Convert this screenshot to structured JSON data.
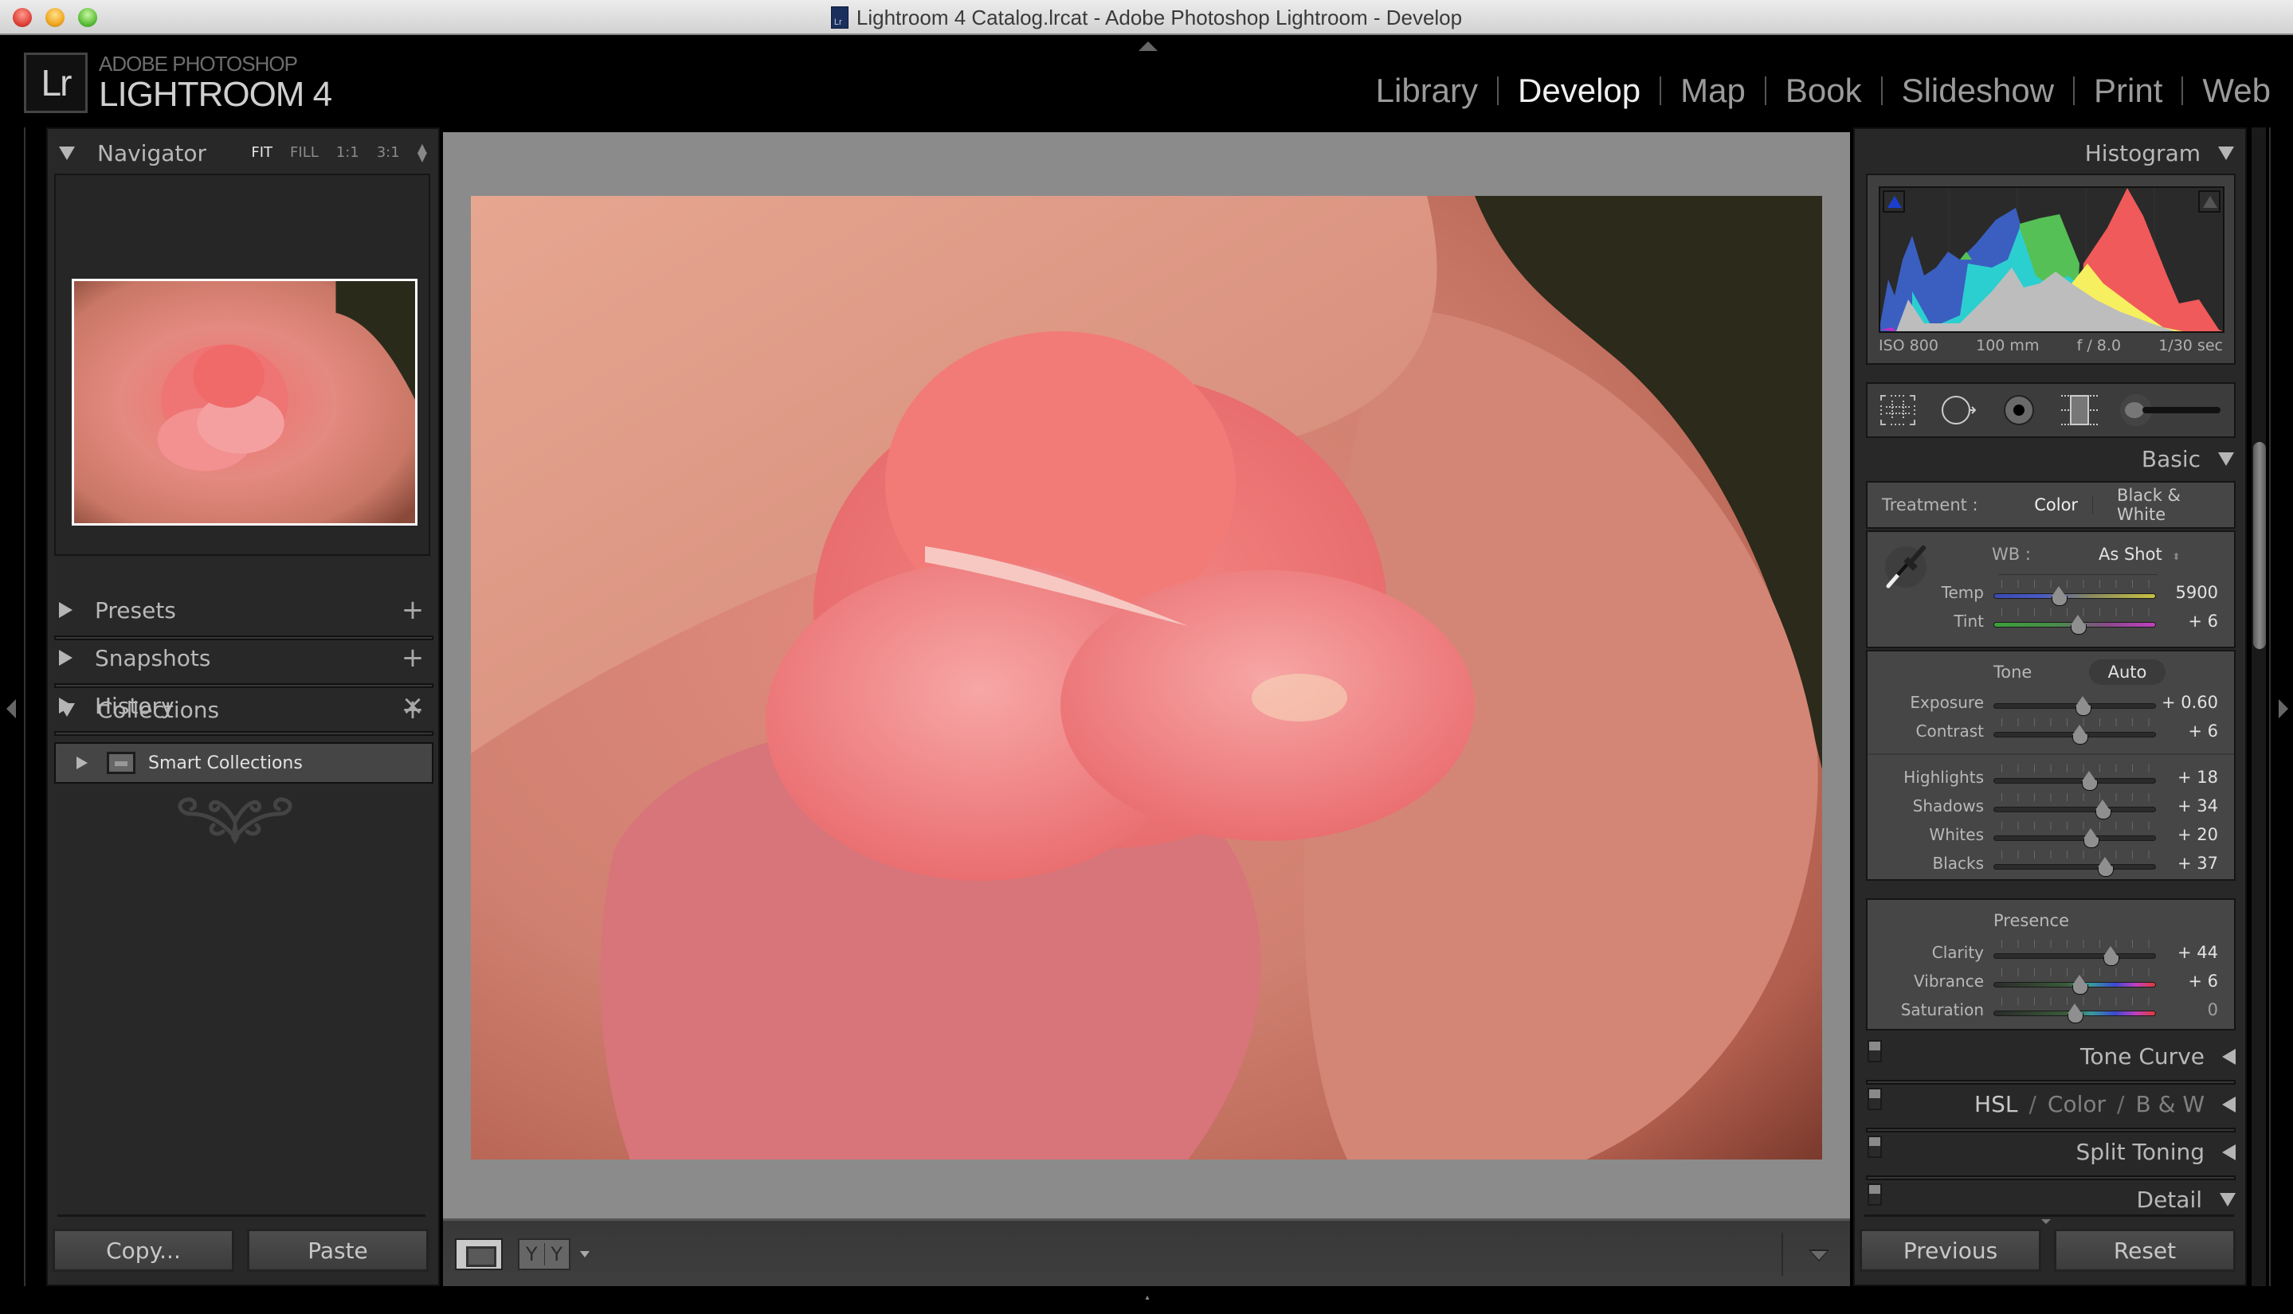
{
  "window": {
    "title": "Lightroom 4 Catalog.lrcat - Adobe Photoshop Lightroom - Develop",
    "traffic_lights": [
      "close",
      "minimize",
      "zoom"
    ]
  },
  "identity": {
    "badge": "Lr",
    "line1": "ADOBE PHOTOSHOP",
    "line2": "LIGHTROOM 4"
  },
  "modules": [
    {
      "label": "Library",
      "active": false
    },
    {
      "label": "Develop",
      "active": true
    },
    {
      "label": "Map",
      "active": false
    },
    {
      "label": "Book",
      "active": false
    },
    {
      "label": "Slideshow",
      "active": false
    },
    {
      "label": "Print",
      "active": false
    },
    {
      "label": "Web",
      "active": false
    }
  ],
  "left_panel": {
    "navigator": {
      "title": "Navigator",
      "zoom_options": [
        "FIT",
        "FILL",
        "1:1",
        "3:1"
      ],
      "active_zoom": "FIT"
    },
    "sections": [
      {
        "title": "Presets",
        "expanded": false,
        "action": "+"
      },
      {
        "title": "Snapshots",
        "expanded": false,
        "action": "+"
      },
      {
        "title": "History",
        "expanded": false,
        "action": "×"
      },
      {
        "title": "Collections",
        "expanded": true,
        "action": "+"
      }
    ],
    "collections": [
      {
        "label": "Smart Collections"
      }
    ],
    "buttons": {
      "copy": "Copy...",
      "paste": "Paste"
    }
  },
  "right_panel": {
    "histogram": {
      "title": "Histogram",
      "iso": "ISO 800",
      "focal_length": "100 mm",
      "aperture": "f / 8.0",
      "shutter": "1/30 sec"
    },
    "tools": [
      "crop-overlay",
      "spot-removal",
      "red-eye-correction",
      "graduated-filter",
      "adjustment-brush"
    ],
    "basic": {
      "title": "Basic",
      "treatment_label": "Treatment :",
      "treatment_options": [
        "Color",
        "Black & White"
      ],
      "treatment_active": "Color",
      "wb_label": "WB :",
      "wb_value": "As Shot",
      "wb_sliders": [
        {
          "label": "Temp",
          "value": "5900",
          "position": 0.4
        },
        {
          "label": "Tint",
          "value": "+ 6",
          "position": 0.52
        }
      ],
      "tone_label": "Tone",
      "auto_label": "Auto",
      "tone_sliders": [
        {
          "label": "Exposure",
          "value": "+ 0.60",
          "position": 0.55
        },
        {
          "label": "Contrast",
          "value": "+ 6",
          "position": 0.53
        }
      ],
      "tone2_sliders": [
        {
          "label": "Highlights",
          "value": "+ 18",
          "position": 0.59
        },
        {
          "label": "Shadows",
          "value": "+ 34",
          "position": 0.67
        },
        {
          "label": "Whites",
          "value": "+ 20",
          "position": 0.6
        },
        {
          "label": "Blacks",
          "value": "+ 37",
          "position": 0.685
        }
      ],
      "presence_label": "Presence",
      "presence_sliders": [
        {
          "label": "Clarity",
          "value": "+ 44",
          "position": 0.72
        },
        {
          "label": "Vibrance",
          "value": "+ 6",
          "position": 0.53
        },
        {
          "label": "Saturation",
          "value": "0",
          "position": 0.5
        }
      ]
    },
    "collapsed_sections": [
      {
        "title": "Tone Curve",
        "expanded": false
      },
      {
        "title_parts": [
          "HSL",
          "Color",
          "B & W"
        ],
        "expanded": false
      },
      {
        "title": "Split Toning",
        "expanded": false
      },
      {
        "title": "Detail",
        "expanded": true
      }
    ],
    "buttons": {
      "previous": "Previous",
      "reset": "Reset"
    }
  },
  "toolbar": {
    "view_modes": [
      "loupe",
      "before-after"
    ],
    "before_after_glyph": "Y"
  },
  "colors": {
    "panel_bg": "#282828",
    "center_bg": "#8b8b8b",
    "histogram_red": "#f05a5a",
    "histogram_green": "#55c055",
    "histogram_blue": "#3a5fc0",
    "histogram_cyan": "#2ccfd0",
    "histogram_yellow": "#f6ef60",
    "histogram_gray": "#bdbdbd"
  }
}
